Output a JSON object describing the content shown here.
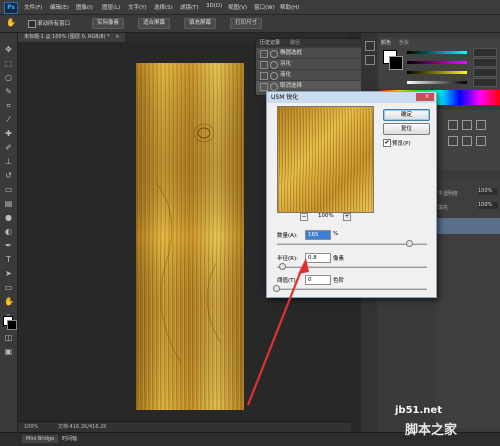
{
  "app": {
    "logo": "Ps"
  },
  "menubar": {
    "items": [
      "文件(F)",
      "编辑(E)",
      "图像(I)",
      "图层(L)",
      "文字(Y)",
      "选择(S)",
      "滤镜(T)",
      "3D(D)",
      "视图(V)",
      "窗口(W)",
      "帮助(H)"
    ]
  },
  "options_bar": {
    "checkbox_label": "滚动所有窗口",
    "buttons": [
      "实际像素",
      "适合屏幕",
      "填充屏幕",
      "打印尺寸"
    ]
  },
  "document": {
    "tab_title": "未标题-1 @ 100% (图层 0, RGB/8) *",
    "close": "×"
  },
  "status": {
    "zoom": "100%",
    "doc_info": "文档:416.2K/416.2K"
  },
  "bottom_tabs": [
    "Mini Bridge",
    "时间轴"
  ],
  "history": {
    "tabs": [
      "历史记录",
      "路径"
    ],
    "rows": [
      "椭圆选框",
      "羽化",
      "液化",
      "取消选择"
    ]
  },
  "right_panels": {
    "color_tabs": [
      "颜色",
      "色板"
    ],
    "layer_labels": [
      "不透明度",
      "填充"
    ],
    "percent_values": [
      "100%",
      "100%"
    ]
  },
  "dialog": {
    "title": "USM 锐化",
    "close": "×",
    "ok_label": "确定",
    "reset_label": "复位",
    "preview_check": "✔",
    "preview_label": "预览(P)",
    "zoom_value": "100%",
    "zoom_minus": "−",
    "zoom_plus": "+",
    "amount_label": "数量(A):",
    "amount_value": "165",
    "amount_unit": "%",
    "radius_label": "半径(R):",
    "radius_value": "0.8",
    "radius_unit": "像素",
    "threshold_label": "阈值(T):",
    "threshold_value": "0",
    "threshold_unit": "色阶"
  },
  "watermark": {
    "line1": "jb51.net",
    "line2": "脚本之家"
  },
  "colors": {
    "arrow": "#e03030",
    "wood_light": "#e8c24a",
    "wood_dark": "#8a5a12",
    "dialog_title": "#cbdcf0"
  }
}
